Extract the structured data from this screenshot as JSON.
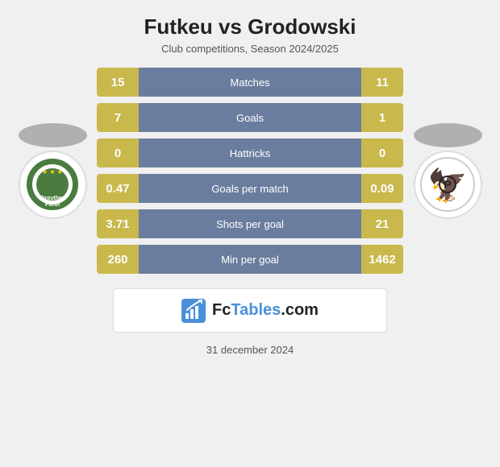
{
  "header": {
    "title": "Futkeu vs Grodowski",
    "subtitle": "Club competitions, Season 2024/2025"
  },
  "stats": [
    {
      "label": "Matches",
      "left": "15",
      "right": "11"
    },
    {
      "label": "Goals",
      "left": "7",
      "right": "1"
    },
    {
      "label": "Hattricks",
      "left": "0",
      "right": "0"
    },
    {
      "label": "Goals per match",
      "left": "0.47",
      "right": "0.09"
    },
    {
      "label": "Shots per goal",
      "left": "3.71",
      "right": "21"
    },
    {
      "label": "Min per goal",
      "left": "260",
      "right": "1462"
    }
  ],
  "banner": {
    "text": "FcTables.com"
  },
  "footer": {
    "date": "31 december 2024"
  }
}
